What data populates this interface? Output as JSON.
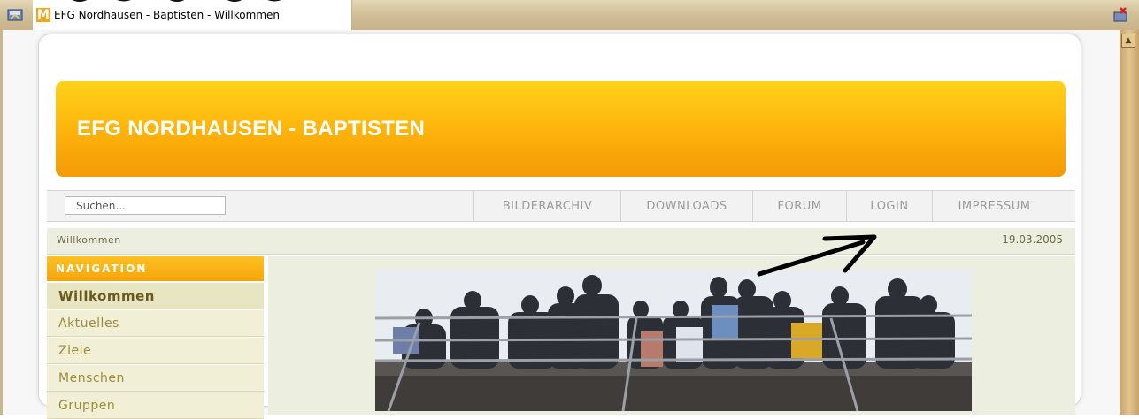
{
  "window": {
    "tab_title": "EFG Nordhausen - Baptisten - Willkommen",
    "tab_icon": "M"
  },
  "header": {
    "site_title": "EFG NORDHAUSEN - BAPTISTEN"
  },
  "search": {
    "value": "Suchen..."
  },
  "menu": {
    "items": [
      {
        "label": "BILDERARCHIV"
      },
      {
        "label": "DOWNLOADS"
      },
      {
        "label": "FORUM"
      },
      {
        "label": "LOGIN"
      },
      {
        "label": "IMPRESSUM"
      }
    ]
  },
  "breadcrumb": {
    "current": "Willkommen",
    "date": "19.03.2005"
  },
  "navigation": {
    "heading": "NAVIGATION",
    "items": [
      {
        "label": "Willkommen",
        "active": true
      },
      {
        "label": "Aktuelles"
      },
      {
        "label": "Ziele"
      },
      {
        "label": "Menschen"
      },
      {
        "label": "Gruppen"
      }
    ]
  },
  "colors": {
    "banner_top": "#ffd21a",
    "banner_bottom": "#f59a08",
    "nav_text": "#9d8a3a",
    "menu_text": "#9a9a9a"
  }
}
